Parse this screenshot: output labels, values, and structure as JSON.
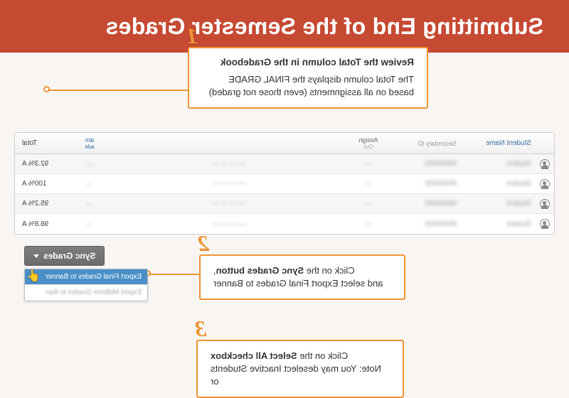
{
  "header": {
    "title": "Submitting End of the Semester Grades"
  },
  "gradebook": {
    "columns": {
      "student_name": "Student Name",
      "secondary_id": "Secondary ID",
      "assignment": "Assign",
      "assignment_sub": "Out",
      "exam_line1": "am",
      "exam_line2": "ade",
      "total": "Total"
    },
    "rows": [
      {
        "total": "92.3% A"
      },
      {
        "total": "100% A"
      },
      {
        "total": "95.2% A"
      },
      {
        "total": "98.8% A"
      }
    ]
  },
  "steps": {
    "s1": {
      "num": "1",
      "title": "Review the Total column in the Gradebook",
      "body": "The Total column displays the FINAL GRADE based  on all assignments (even those not graded)"
    },
    "s2": {
      "num": "2",
      "line1_a": "Click on the ",
      "line1_b": "Sync Grades button",
      "line1_c": ",",
      "line2": "and select Export Final Grades to Banner"
    },
    "s3": {
      "num": "3",
      "line1_a": "Click on the ",
      "line1_b": "Select All checkbox",
      "line2": "Note: You may deselect Inactive Students or"
    }
  },
  "sync": {
    "button": "Sync Grades",
    "item_active": "Export Final Grades to Banner",
    "item_dim": "Export Midterm Grades to Ban"
  }
}
